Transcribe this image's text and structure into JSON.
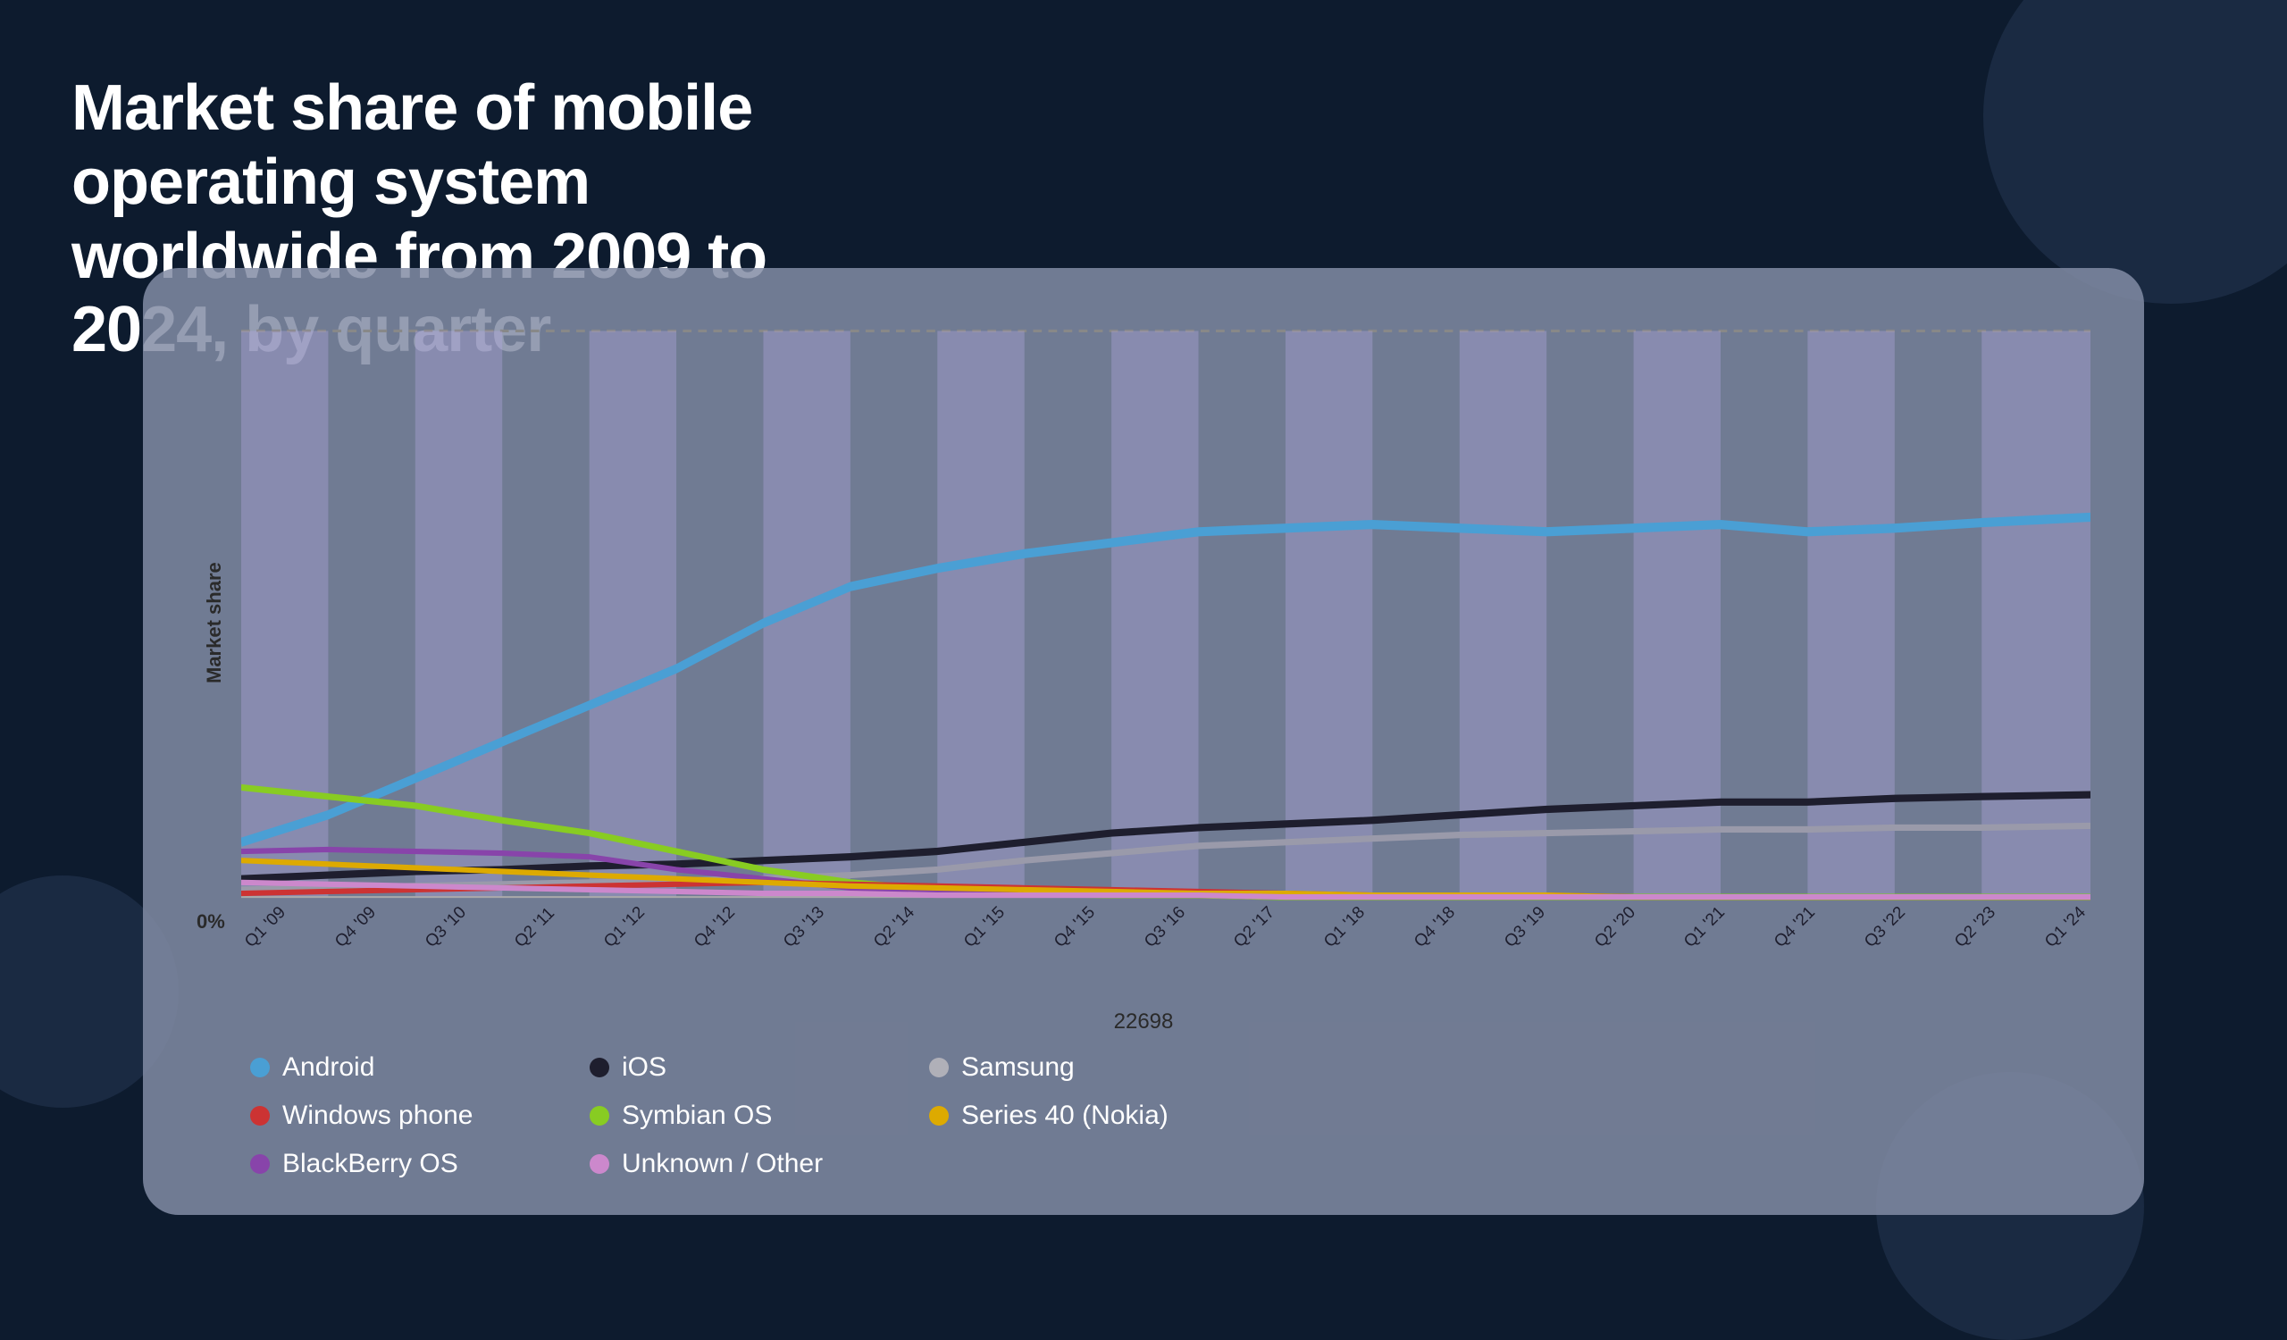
{
  "title": {
    "line1": "Market share of mobile operating system",
    "line2": "worldwide from 2009 to 2024, by quarter"
  },
  "chart": {
    "y_axis_label": "Market share",
    "zero_label": "0%",
    "chart_number": "22698",
    "x_labels": [
      "Q1 '09",
      "Q4 '09",
      "Q3 '10",
      "Q2 '11",
      "Q1 '12",
      "Q4 '12",
      "Q3 '13",
      "Q2 '14",
      "Q1 '15",
      "Q4 '15",
      "Q3 '16",
      "Q2 '17",
      "Q1 '18",
      "Q4 '18",
      "Q3 '19",
      "Q2 '20",
      "Q1 '21",
      "Q4 '21",
      "Q3 '22",
      "Q2 '23",
      "Q1 '24"
    ]
  },
  "legend": {
    "items": [
      {
        "label": "Android",
        "color": "#4a9fd4",
        "row": 0,
        "col": 0
      },
      {
        "label": "iOS",
        "color": "#1a1a2e",
        "row": 0,
        "col": 1
      },
      {
        "label": "Samsung",
        "color": "#b0b0b8",
        "row": 0,
        "col": 2
      },
      {
        "label": "Windows phone",
        "color": "#cc3333",
        "row": 1,
        "col": 0
      },
      {
        "label": "Symbian OS",
        "color": "#88cc22",
        "row": 1,
        "col": 1
      },
      {
        "label": "Series 40 (Nokia)",
        "color": "#ddaa00",
        "row": 1,
        "col": 2
      },
      {
        "label": "BlackBerry OS",
        "color": "#8844aa",
        "row": 2,
        "col": 0
      },
      {
        "label": "Unknown / Other",
        "color": "#cc88cc",
        "row": 2,
        "col": 1
      }
    ]
  },
  "colors": {
    "background": "#0d1b2e",
    "chart_bg": "rgba(130,140,165,0.85)",
    "android": "#4a9fd4",
    "ios": "#1e1e2e",
    "samsung": "#9a9aaa",
    "windows_phone": "#cc3333",
    "symbian": "#88cc22",
    "series40": "#ddaa00",
    "blackberry": "#8844aa",
    "unknown": "#cc88cc",
    "band_fill": "rgba(180,170,220,0.45)"
  }
}
